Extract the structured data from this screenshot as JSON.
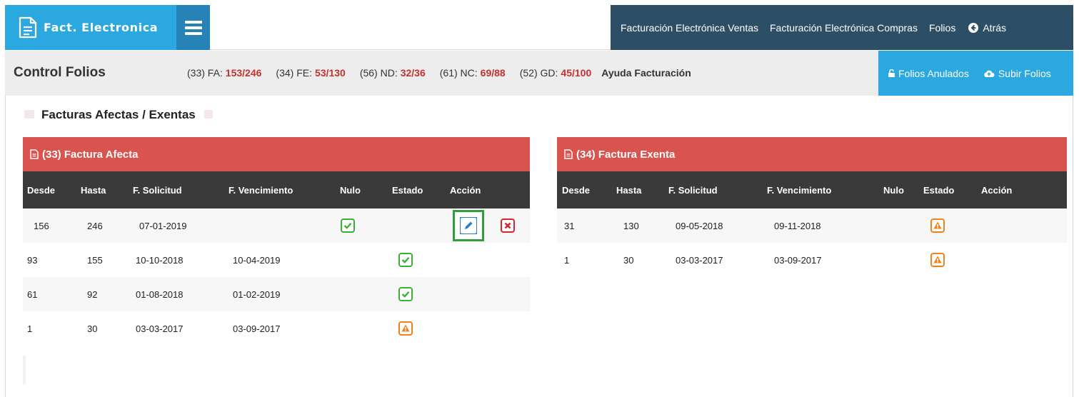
{
  "topbar": {
    "brand": "Fact. Electronica",
    "nav": [
      "Facturación Electrónica Ventas",
      "Facturación Electrónica Compras",
      "Folios",
      "Atrás"
    ]
  },
  "control": {
    "title": "Control Folios",
    "counters": [
      {
        "label": "(33) FA:",
        "value": "153/246"
      },
      {
        "label": "(34) FE:",
        "value": "53/130"
      },
      {
        "label": "(56) ND:",
        "value": "32/36"
      },
      {
        "label": "(61) NC:",
        "value": "69/88"
      },
      {
        "label": "(52) GD:",
        "value": "45/100"
      }
    ],
    "help": "Ayuda Facturación",
    "actions": [
      "Folios Anulados",
      "Subir Folios"
    ]
  },
  "section": {
    "title": "Facturas Afectas / Exentas"
  },
  "columns": [
    "Desde",
    "Hasta",
    "F. Solicitud",
    "F. Vencimiento",
    "Nulo",
    "Estado",
    "Acción"
  ],
  "afecta": {
    "title": "(33) Factura Afecta",
    "rows": [
      {
        "desde": "156",
        "hasta": "246",
        "solicitud": "07-01-2019",
        "vencimiento": "",
        "nulo": "check-icon",
        "estado": "",
        "accion": "edit-icon, delete-icon"
      },
      {
        "desde": "93",
        "hasta": "155",
        "solicitud": "10-10-2018",
        "vencimiento": "10-04-2019",
        "nulo": "",
        "estado": "check-icon",
        "accion": ""
      },
      {
        "desde": "61",
        "hasta": "92",
        "solicitud": "01-08-2018",
        "vencimiento": "01-02-2019",
        "nulo": "",
        "estado": "check-icon",
        "accion": ""
      },
      {
        "desde": "1",
        "hasta": "30",
        "solicitud": "03-03-2017",
        "vencimiento": "03-09-2017",
        "nulo": "",
        "estado": "warning-icon",
        "accion": ""
      }
    ]
  },
  "exenta": {
    "title": "(34) Factura Exenta",
    "rows": [
      {
        "desde": "31",
        "hasta": "130",
        "solicitud": "09-05-2018",
        "vencimiento": "09-11-2018",
        "nulo": "",
        "estado": "warning-icon",
        "accion": ""
      },
      {
        "desde": "1",
        "hasta": "30",
        "solicitud": "03-03-2017",
        "vencimiento": "03-09-2017",
        "nulo": "",
        "estado": "warning-icon",
        "accion": ""
      }
    ]
  },
  "colors": {
    "brand": "#2ca8e0",
    "nav": "#2d4f66",
    "panel_header": "#d9534f",
    "table_header": "#3a3a3a",
    "count": "#c9302c",
    "ok": "#3cb033",
    "warn": "#f0821e",
    "danger": "#d9232f",
    "edit_highlight": "#2e9e3f"
  }
}
